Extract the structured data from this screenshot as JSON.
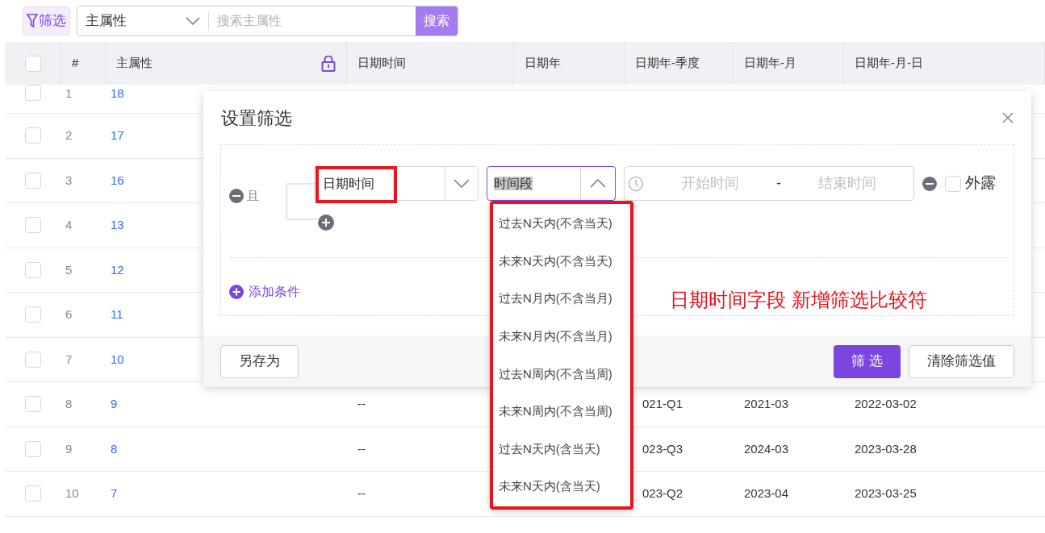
{
  "toolbar": {
    "filter_button": "筛选",
    "field_select": "主属性",
    "search": {
      "placeholder": "搜索主属性"
    },
    "search_button": "搜索"
  },
  "table": {
    "select_all": {
      "checked": false
    },
    "columns": [
      {
        "label": "#"
      },
      {
        "label": "主属性",
        "locked": true
      },
      {
        "label": "日期时间"
      },
      {
        "label": "日期年"
      },
      {
        "label": "日期年-季度"
      },
      {
        "label": "日期年-月"
      },
      {
        "label": "日期年-月-日"
      }
    ],
    "rows": [
      {
        "index": "1",
        "value": "18",
        "checked": false
      },
      {
        "index": "2",
        "value": "17",
        "checked": false
      },
      {
        "index": "3",
        "value": "16",
        "checked": false
      },
      {
        "index": "4",
        "value": "13",
        "checked": false
      },
      {
        "index": "5",
        "value": "12",
        "checked": false
      },
      {
        "index": "6",
        "value": "11",
        "checked": false
      },
      {
        "index": "7",
        "value": "10",
        "checked": false
      },
      {
        "index": "8",
        "value": "9",
        "checked": false,
        "datetime": "--",
        "quarter": "021-Q1",
        "month": "2021-03",
        "day": "2022-03-02"
      },
      {
        "index": "9",
        "value": "8",
        "checked": false,
        "datetime": "--",
        "quarter": "023-Q3",
        "month": "2024-03",
        "day": "2023-03-28"
      },
      {
        "index": "10",
        "value": "7",
        "checked": false,
        "datetime": "--",
        "quarter": "023-Q2",
        "month": "2023-04",
        "day": "2023-03-25"
      }
    ]
  },
  "dialog": {
    "title": "设置筛选",
    "logic": "且",
    "field": "日期时间",
    "operator": "时间段",
    "operator_open": true,
    "start_placeholder": "开始时间",
    "separator": "-",
    "end_placeholder": "结束时间",
    "exposed": {
      "label": "外露",
      "checked": false
    },
    "add_condition": "添加条件",
    "save_as": "另存为",
    "apply": "筛 选",
    "clear": "清除筛选值"
  },
  "dropdown": [
    "过去N天内(不含当天)",
    "未来N天内(不含当天)",
    "过去N月内(不含当月)",
    "未来N月内(不含当月)",
    "过去N周内(不含当周)",
    "未来N周内(不含当周)",
    "过去N天内(含当天)",
    "未来N天内(含当天)"
  ],
  "annotation": "日期时间字段 新增筛选比较符"
}
